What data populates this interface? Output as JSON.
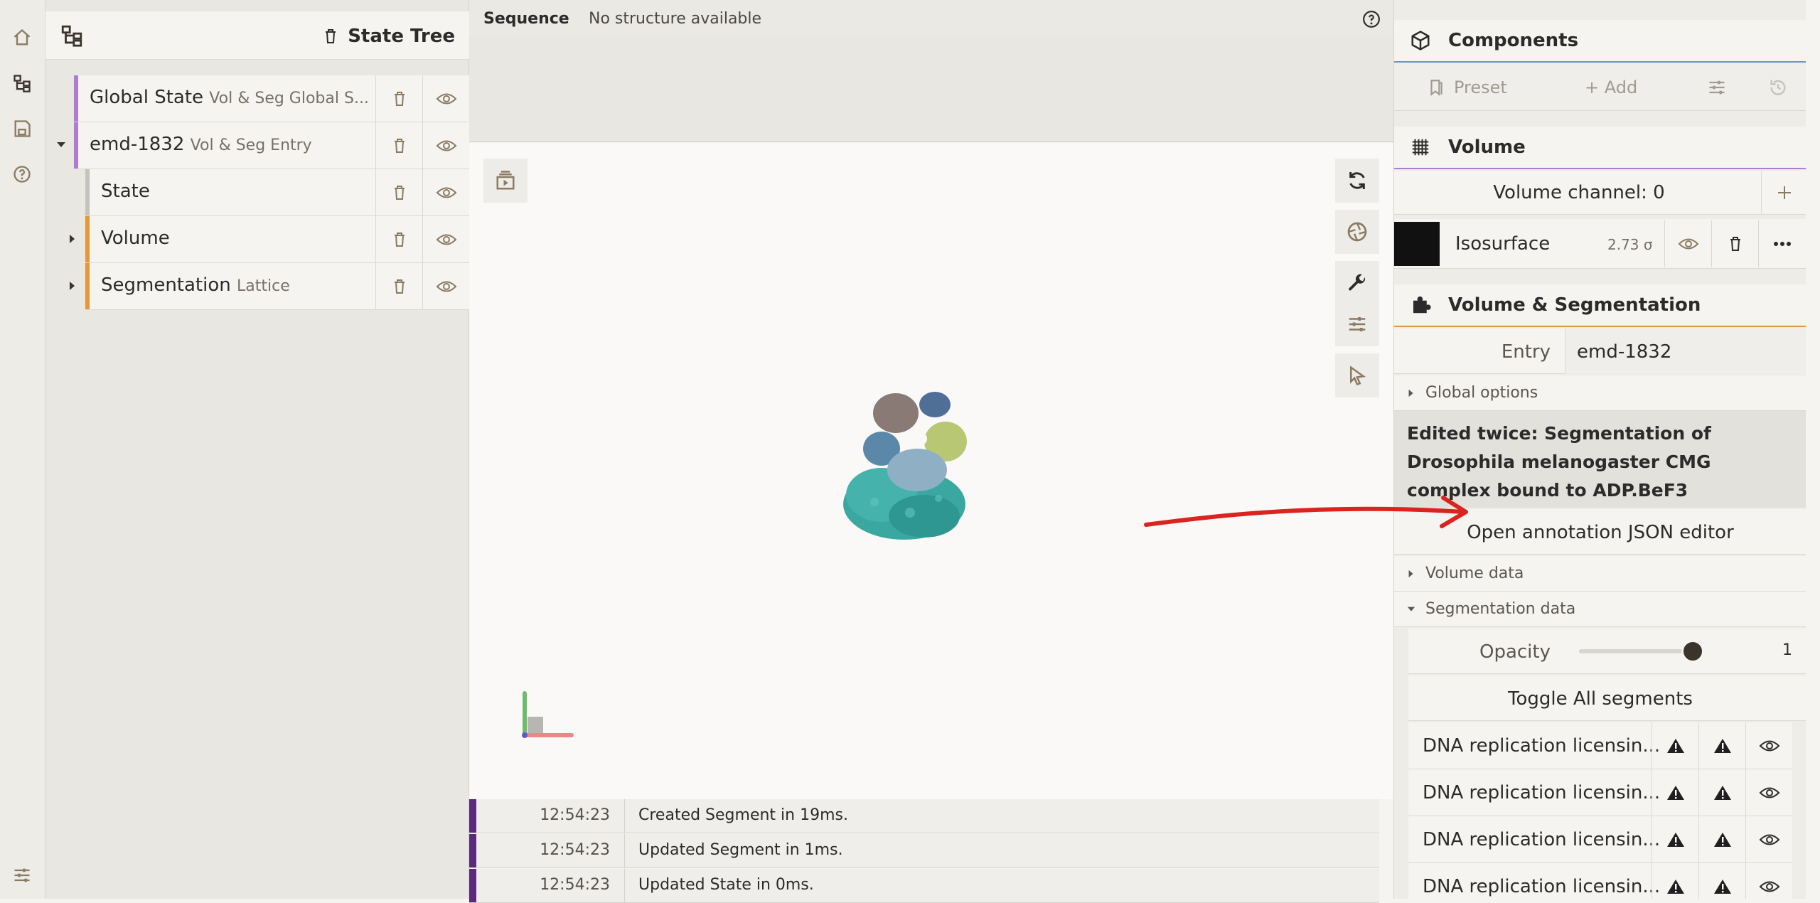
{
  "rail": {
    "icons": [
      "home-icon",
      "tree-icon",
      "save-icon",
      "help-icon",
      "settings-icon"
    ]
  },
  "state_tree": {
    "title": "State Tree",
    "rows": [
      {
        "label": "Global State",
        "sub": "Vol & Seg Global S..."
      },
      {
        "label": "emd-1832",
        "sub": "Vol & Seg Entry"
      },
      {
        "label": "State",
        "sub": ""
      },
      {
        "label": "Volume",
        "sub": ""
      },
      {
        "label": "Segmentation",
        "sub": "Lattice"
      }
    ]
  },
  "sequence": {
    "label": "Sequence",
    "status": "No structure available"
  },
  "log": [
    {
      "time": "12:54:23",
      "message": "Created Segment in 19ms."
    },
    {
      "time": "12:54:23",
      "message": "Updated Segment in 1ms."
    },
    {
      "time": "12:54:23",
      "message": "Updated State in 0ms."
    }
  ],
  "components": {
    "title": "Components",
    "preset_label": "Preset",
    "add_label": "+ Add"
  },
  "volume": {
    "title": "Volume",
    "channel_label": "Volume channel: 0",
    "representation": {
      "name": "Isosurface",
      "value": "2.73 σ",
      "color": "#111111"
    }
  },
  "volseg": {
    "title": "Volume & Segmentation",
    "entry_label": "Entry",
    "entry_value": "emd-1832",
    "global_options": "Global options",
    "description": "Edited twice: Segmentation of Drosophila melanogaster CMG complex bound to ADP.BeF3",
    "json_editor_button": "Open annotation JSON editor",
    "volume_data": "Volume data",
    "segmentation_data": "Segmentation data",
    "opacity_label": "Opacity",
    "opacity_value": "1",
    "opacity_level": 1,
    "toggle_all": "Toggle All segments",
    "segments": [
      "DNA replication licensin...",
      "DNA replication licensin...",
      "DNA replication licensin...",
      "DNA replication licensin..."
    ]
  },
  "colors": {
    "accent_purple": "#b07ad6",
    "accent_orange": "#e8953a",
    "accent_gray": "#c6c3bc",
    "log_bar": "#5b2a7a",
    "annotation_arrow": "#d9241f"
  }
}
